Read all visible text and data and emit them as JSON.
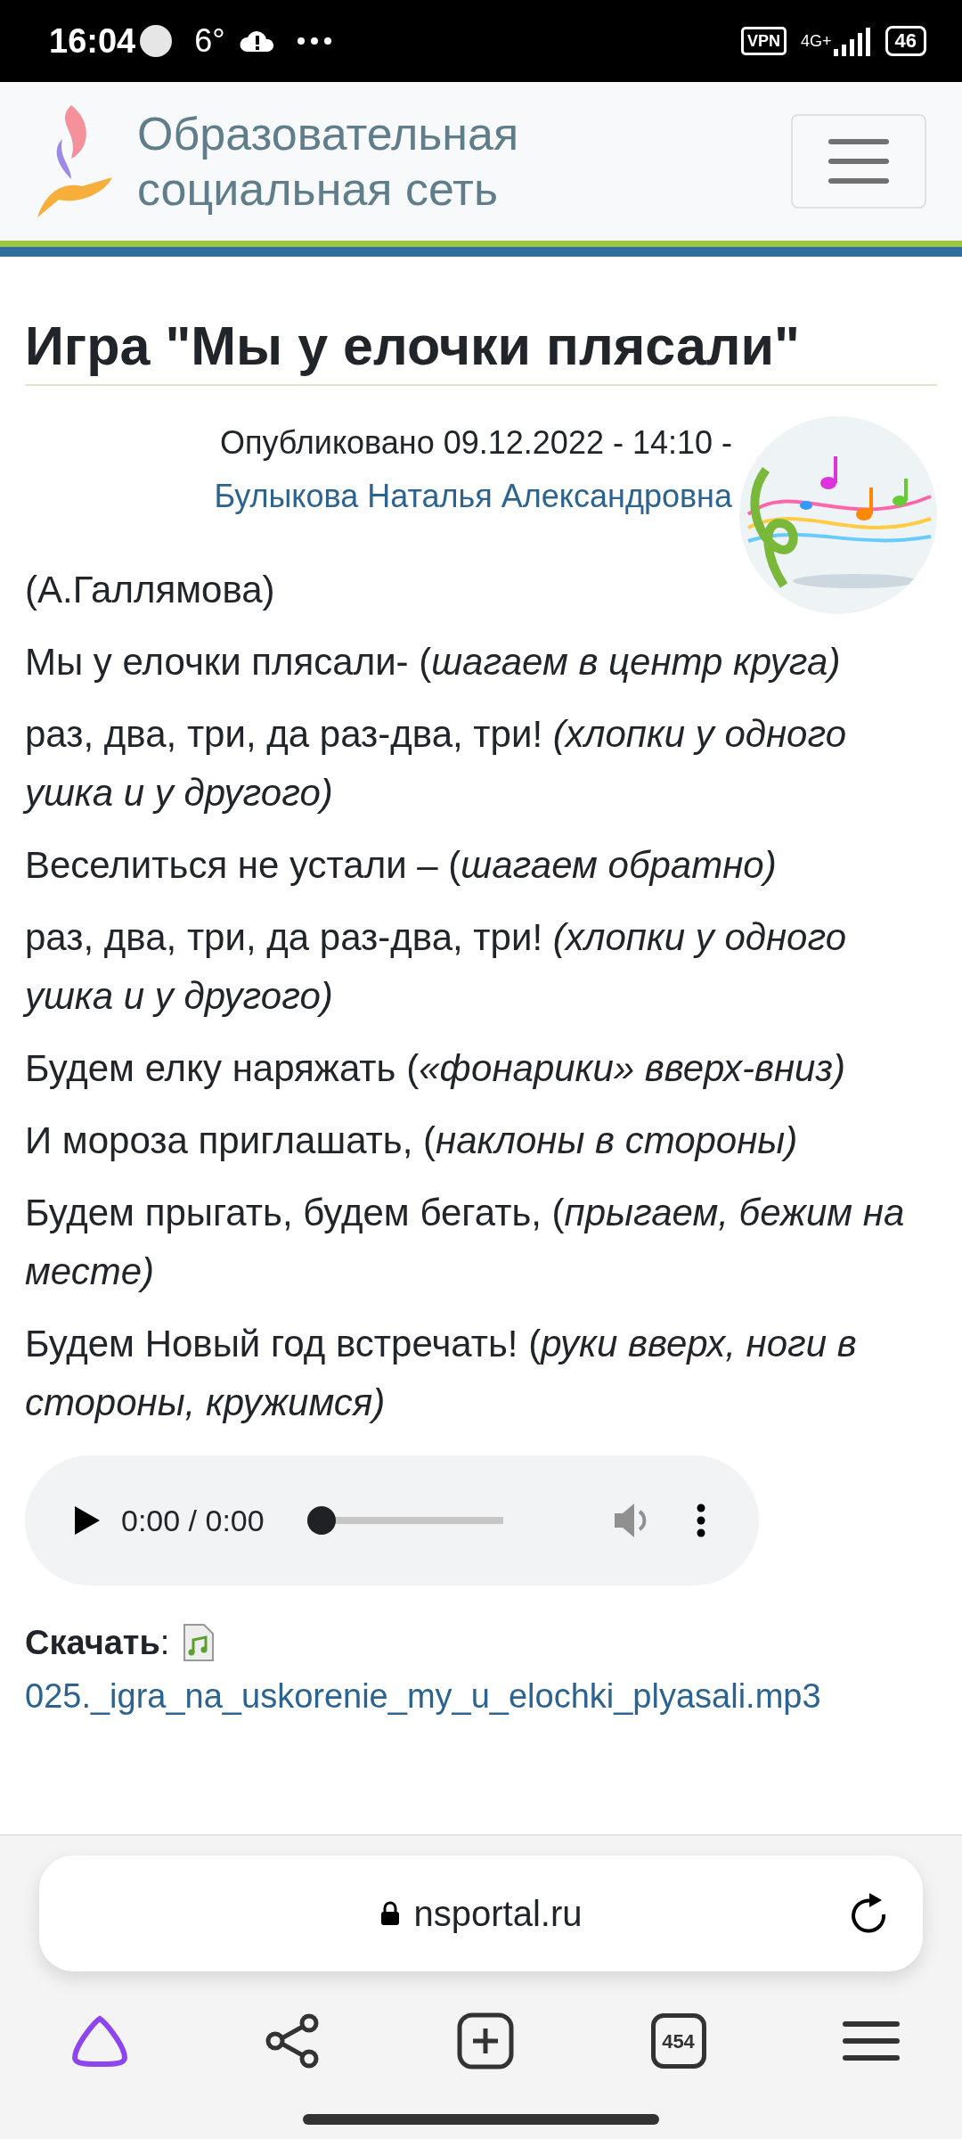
{
  "status_bar": {
    "time": "16:04",
    "temperature": "6°",
    "vpn": "VPN",
    "network": "4G+",
    "battery": "46"
  },
  "header": {
    "brand_lines": [
      "Образовательная",
      "социальная сеть"
    ]
  },
  "article": {
    "title": "Игра \"Мы у елочки плясали\"",
    "published": "Опубликовано 09.12.2022 - 14:10 -",
    "author": "Булыкова Наталья Александровна",
    "paragraphs": [
      "(А.Галлямова)",
      "Мы у елочки плясали- (*шагаем в центр круга)*",
      "раз, два, три, да раз-два, три! *(хлопки у одного ушка и у другого)*",
      "Веселиться не устали – (*шагаем обратно)*",
      "раз, два, три, да раз-два, три! *(хлопки у одного ушка и у другого)*",
      "Будем елку наряжать (*«фонарики» вверх-вниз)*",
      "И мороза приглашать, (*наклоны в стороны)*",
      "Будем прыгать, будем бегать, (*прыгаем, бежим на месте)*",
      "Будем Новый год встречать! (*руки вверх, ноги в стороны, кружимся)*"
    ]
  },
  "audio": {
    "time": "0:00 / 0:00",
    "level": 0
  },
  "download": {
    "label": "**Скачать**:",
    "file": "025._igra_na_uskorenie_my_u_elochki_plyasali.mp3"
  },
  "browser": {
    "url": "nsportal.ru",
    "tab_count": "454"
  }
}
